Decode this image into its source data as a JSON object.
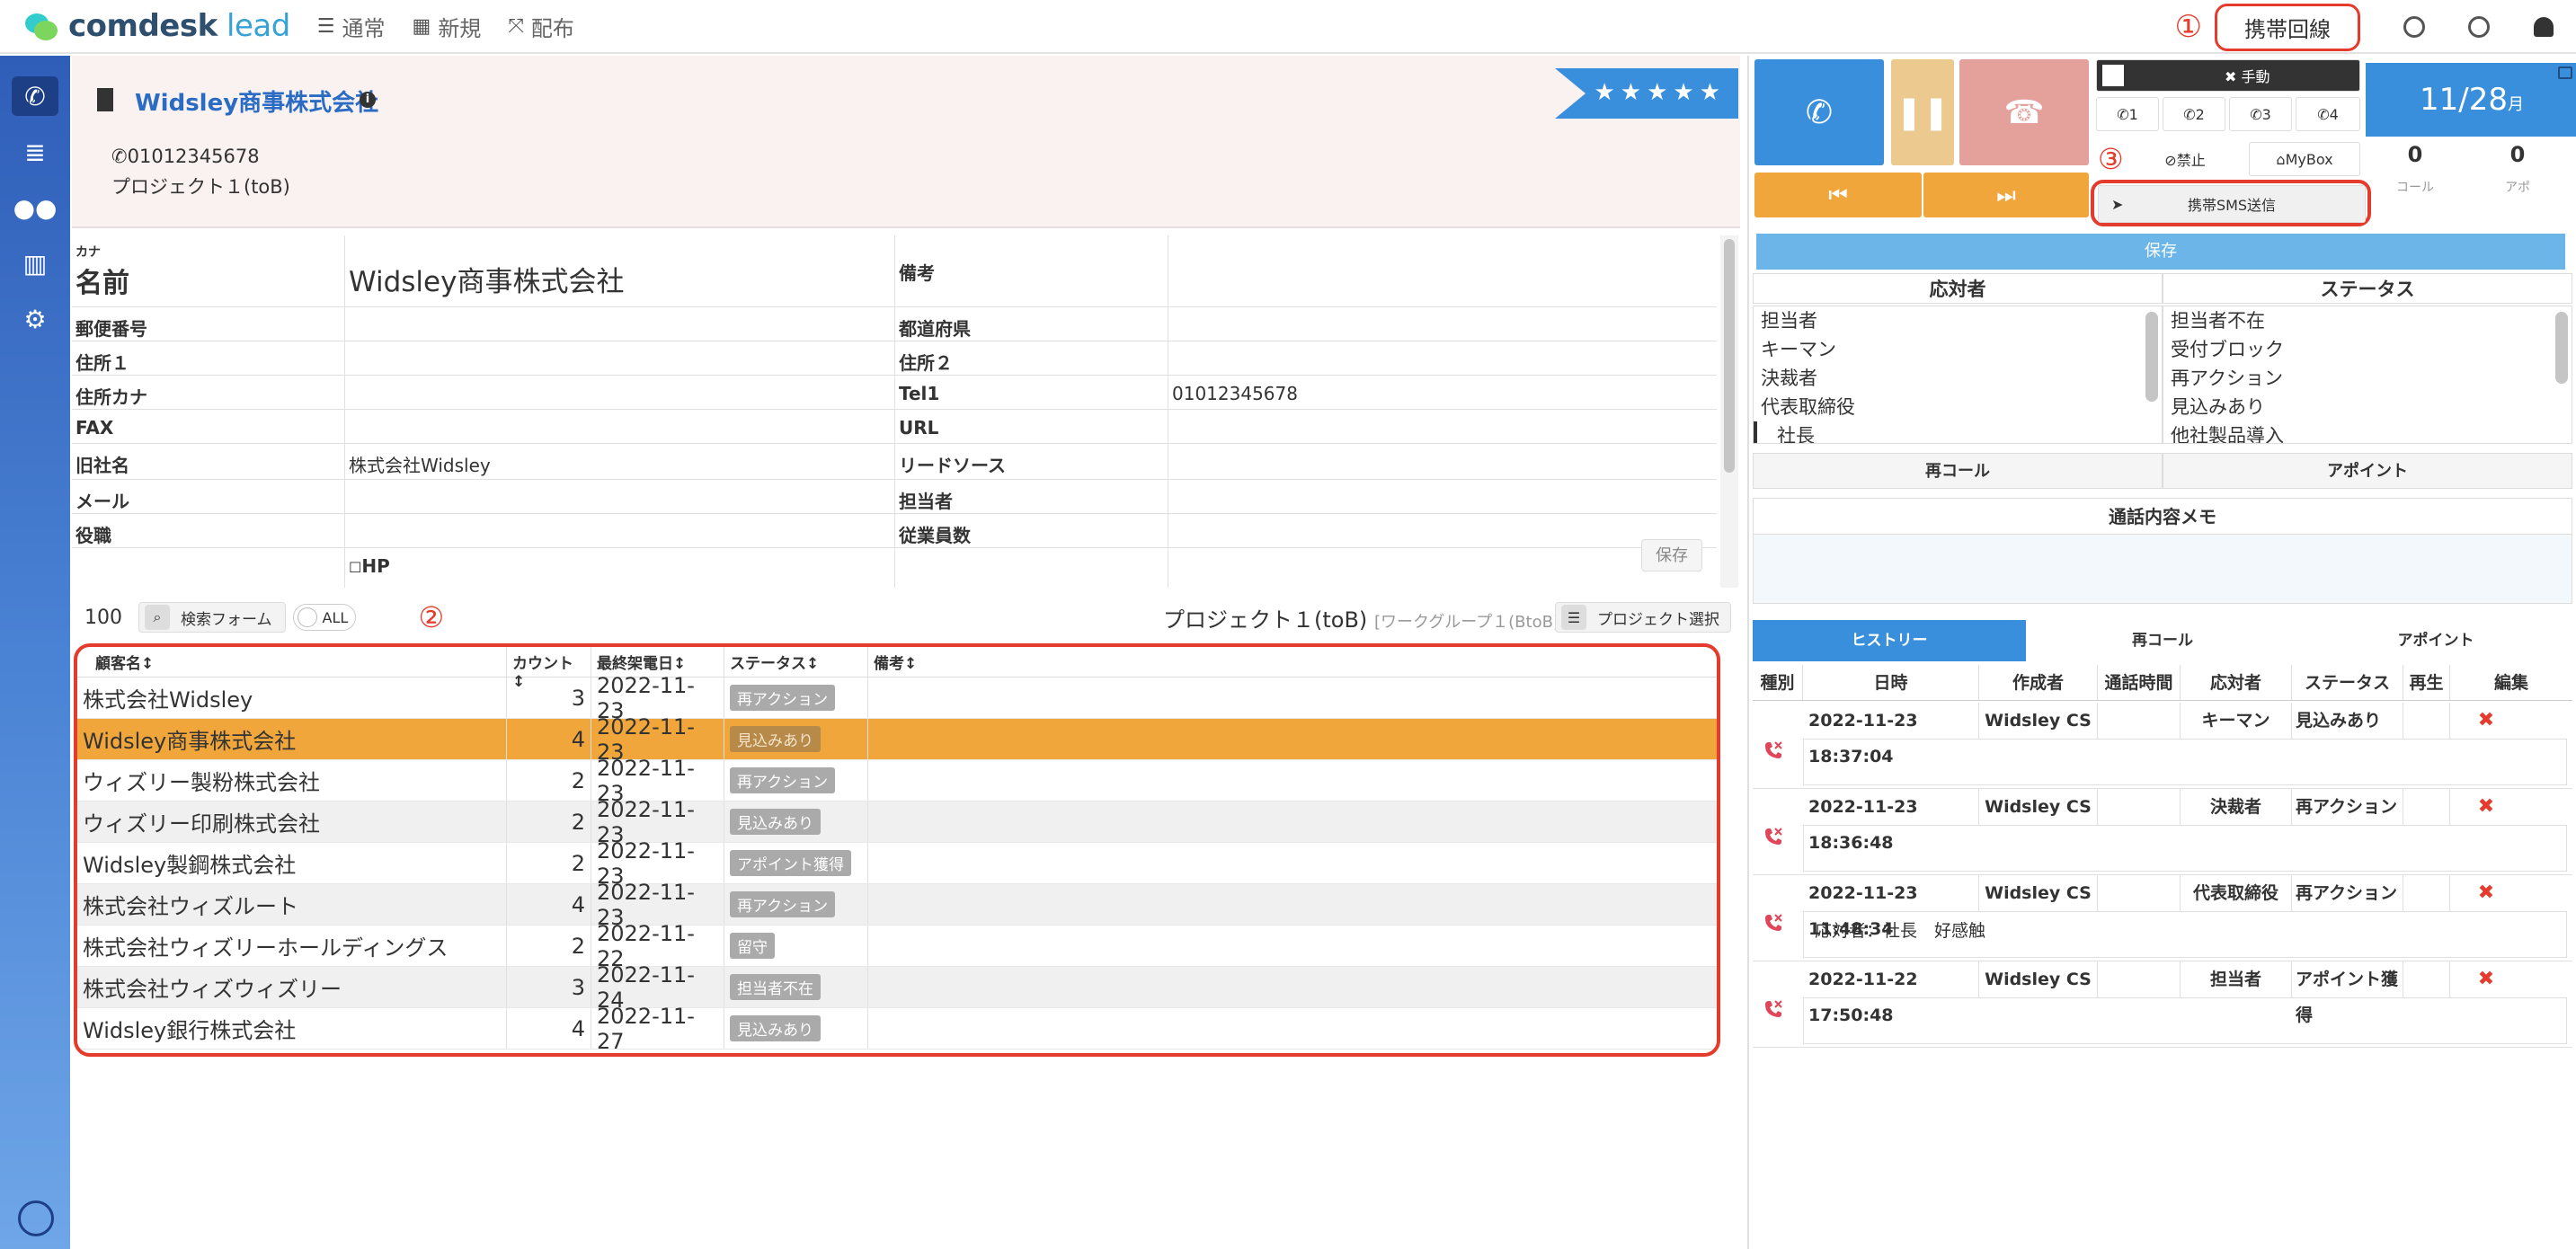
{
  "app": {
    "logo_main": "comdesk",
    "logo_sub": " lead"
  },
  "topnav": [
    {
      "icon": "☰",
      "label": "通常"
    },
    {
      "icon": "▦",
      "label": "新規"
    },
    {
      "icon": "⤧",
      "label": "配布"
    }
  ],
  "topright": {
    "annotation": "①",
    "mobile_line": "携帯回線"
  },
  "company": {
    "name": "Widsley商事株式会社",
    "phone": "01012345678",
    "project": "プロジェクト１(toB)",
    "stars": "★★★★★"
  },
  "form": {
    "kana_label": "カナ",
    "name_label": "名前",
    "name_value": "Widsley商事株式会社",
    "remarks_label": "備考",
    "rows": [
      {
        "l1": "郵便番号",
        "v1": "",
        "l2": "都道府県",
        "v2": ""
      },
      {
        "l1": "住所１",
        "v1": "",
        "l2": "住所２",
        "v2": ""
      },
      {
        "l1": "住所カナ",
        "v1": "",
        "l2": "Tel1",
        "v2": "01012345678"
      },
      {
        "l1": "FAX",
        "v1": "",
        "l2": "URL",
        "v2": ""
      },
      {
        "l1": "旧社名",
        "v1": "株式会社Widsley",
        "l2": "リードソース",
        "v2": ""
      },
      {
        "l1": "メール",
        "v1": "",
        "l2": "担当者",
        "v2": ""
      },
      {
        "l1": "役職",
        "v1": "",
        "l2": "従業員数",
        "v2": ""
      }
    ],
    "hp_checkbox": "HP",
    "save_label": "保存"
  },
  "list_toolbar": {
    "count": "100",
    "search_label": "検索フォーム",
    "toggle_label": "ALL",
    "annotation": "②",
    "project_title": "プロジェクト１(toB)",
    "project_sub": "[ワークグループ１(BtoB)]",
    "project_select": "プロジェクト選択"
  },
  "list": {
    "headers": [
      "顧客名↕",
      "カウント↕",
      "最終架電日↕",
      "ステータス↕",
      "備考↕"
    ],
    "rows": [
      {
        "name": "株式会社Widsley",
        "count": "3",
        "date": "2022-11-23",
        "status": "再アクション",
        "note": ""
      },
      {
        "name": "Widsley商事株式会社",
        "count": "4",
        "date": "2022-11-23",
        "status": "見込みあり",
        "note": ""
      },
      {
        "name": "ウィズリー製粉株式会社",
        "count": "2",
        "date": "2022-11-23",
        "status": "再アクション",
        "note": ""
      },
      {
        "name": "ウィズリー印刷株式会社",
        "count": "2",
        "date": "2022-11-23",
        "status": "見込みあり",
        "note": ""
      },
      {
        "name": "Widsley製鋼株式会社",
        "count": "2",
        "date": "2022-11-23",
        "status": "アポイント獲得",
        "note": ""
      },
      {
        "name": "株式会社ウィズルート",
        "count": "4",
        "date": "2022-11-23",
        "status": "再アクション",
        "note": ""
      },
      {
        "name": "株式会社ウィズリーホールディングス",
        "count": "2",
        "date": "2022-11-22",
        "status": "留守",
        "note": ""
      },
      {
        "name": "株式会社ウィズウィズリー",
        "count": "3",
        "date": "2022-11-24",
        "status": "担当者不在",
        "note": ""
      },
      {
        "name": "Widsley銀行株式会社",
        "count": "4",
        "date": "2022-11-27",
        "status": "見込みあり",
        "note": ""
      }
    ]
  },
  "phone_panel": {
    "manual_label": "✖ 手動",
    "lines": [
      "1",
      "2",
      "3",
      "4"
    ],
    "ban_label": "⊘禁止",
    "mybox_label": "MyBox",
    "annotation": "③",
    "sms_label": "携帯SMS送信",
    "date": "11/28",
    "date_suffix": "月",
    "calls": "0",
    "calls_label": "コール",
    "appo": "0",
    "appo_label": "アポ",
    "save_label": "保存"
  },
  "selectors": {
    "responder_title": "応対者",
    "status_title": "ステータス",
    "responders": [
      "担当者",
      "キーマン",
      "決裁者",
      "代表取締役",
      "社長"
    ],
    "statuses": [
      "担当者不在",
      "受付ブロック",
      "再アクション",
      "見込みあり",
      "他社製品導入"
    ]
  },
  "action_tabs": {
    "recall": "再コール",
    "appoint": "アポイント"
  },
  "memo_title": "通話内容メモ",
  "history_tabs": [
    "ヒストリー",
    "再コール",
    "アポイント"
  ],
  "history_headers": [
    "種別",
    "日時",
    "作成者",
    "通話時間",
    "応対者",
    "ステータス",
    "再生",
    "編集"
  ],
  "history": [
    {
      "datetime": "2022-11-23 18:37:04",
      "author": "Widsley CS",
      "duration": "",
      "responder": "キーマン",
      "status": "見込みあり",
      "memo": ""
    },
    {
      "datetime": "2022-11-23 18:36:48",
      "author": "Widsley CS",
      "duration": "",
      "responder": "決裁者",
      "status": "再アクション",
      "memo": ""
    },
    {
      "datetime": "2022-11-23 11:48:34",
      "author": "Widsley CS",
      "duration": "",
      "responder": "代表取締役",
      "status": "再アクション",
      "memo": "応対者：社長　好感触"
    },
    {
      "datetime": "2022-11-22 17:50:48",
      "author": "Widsley CS",
      "duration": "",
      "responder": "担当者",
      "status": "アポイント獲得",
      "memo": ""
    }
  ],
  "colors": {
    "accent": "#3a8fdc",
    "selected_row": "#f0a63a",
    "annotation_red": "#e53b2c",
    "hangup": "#e4a09b",
    "hold": "#ebc98f",
    "skip": "#f0a63a"
  }
}
